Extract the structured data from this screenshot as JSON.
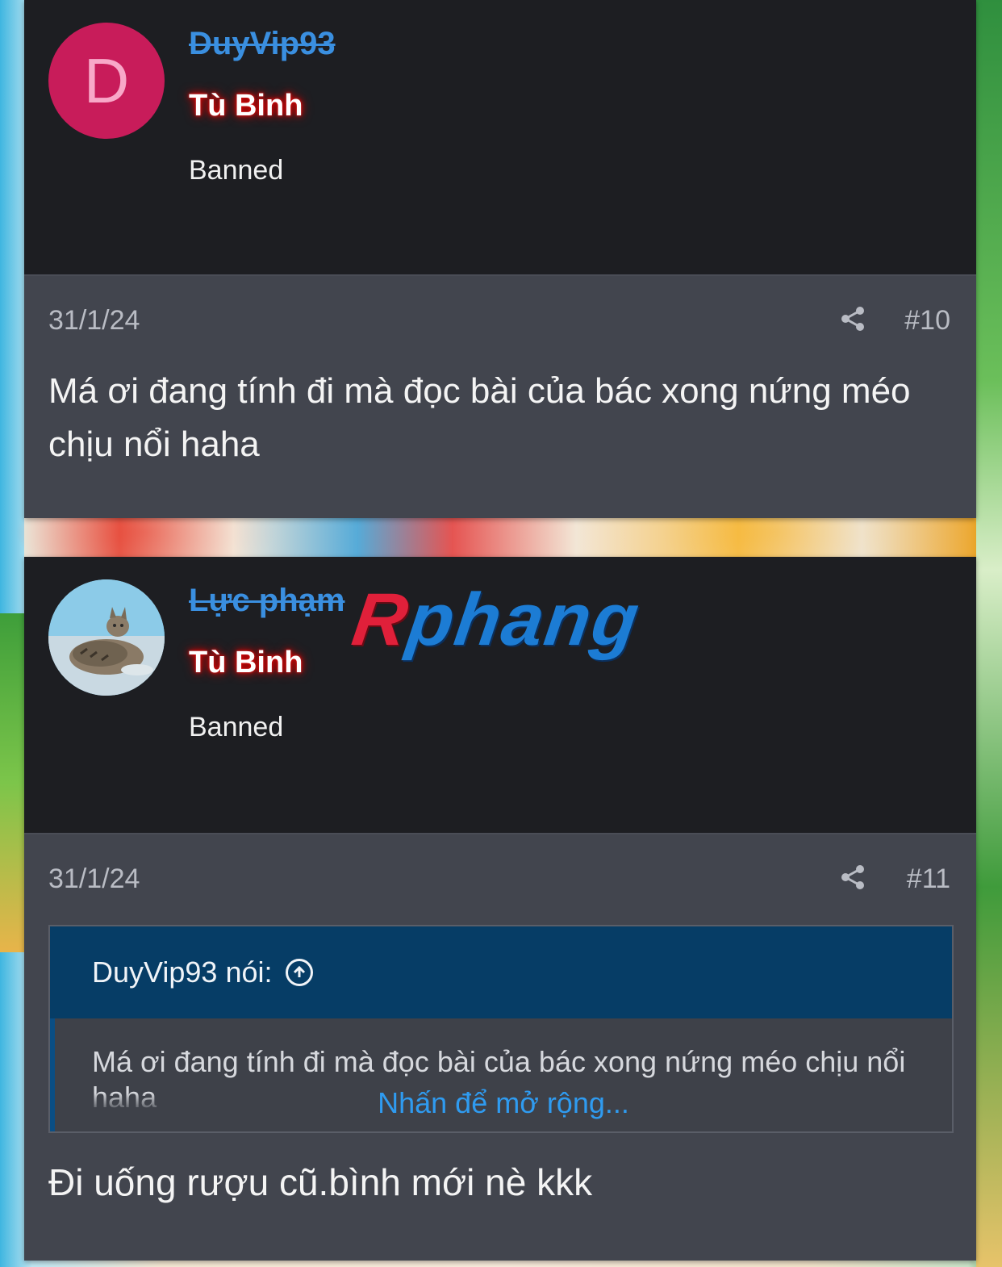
{
  "posts": [
    {
      "username": "DuyVip93",
      "avatar_letter": "D",
      "user_title": "Tù Binh",
      "status": "Banned",
      "date": "31/1/24",
      "number": "#10",
      "message": "Má ơi đang tính đi mà đọc bài của bác xong nứng méo chịu nổi haha"
    },
    {
      "username": "Lực phạm",
      "user_title": "Tù Binh",
      "status": "Banned",
      "date": "31/1/24",
      "number": "#11",
      "quote": {
        "author": "DuyVip93 nói:",
        "text": "Má ơi đang tính đi mà đọc bài của bác xong nứng méo chịu nổi haha",
        "expand_label": "Nhấn để mở rộng..."
      },
      "message": "Đi uống rượu cũ.bình mới nè kkk"
    }
  ],
  "watermark": {
    "first": "R",
    "rest": "phang"
  },
  "icons": {
    "share": "share-icon",
    "quote_jump": "arrow-up-circle-icon"
  },
  "colors": {
    "user_block_bg": "#1d1e22",
    "content_bg": "#42454e",
    "username": "#3a8fe0",
    "title_glow": "#e00000",
    "quote_header": "#063d66",
    "expand_link": "#2f9bf0"
  }
}
